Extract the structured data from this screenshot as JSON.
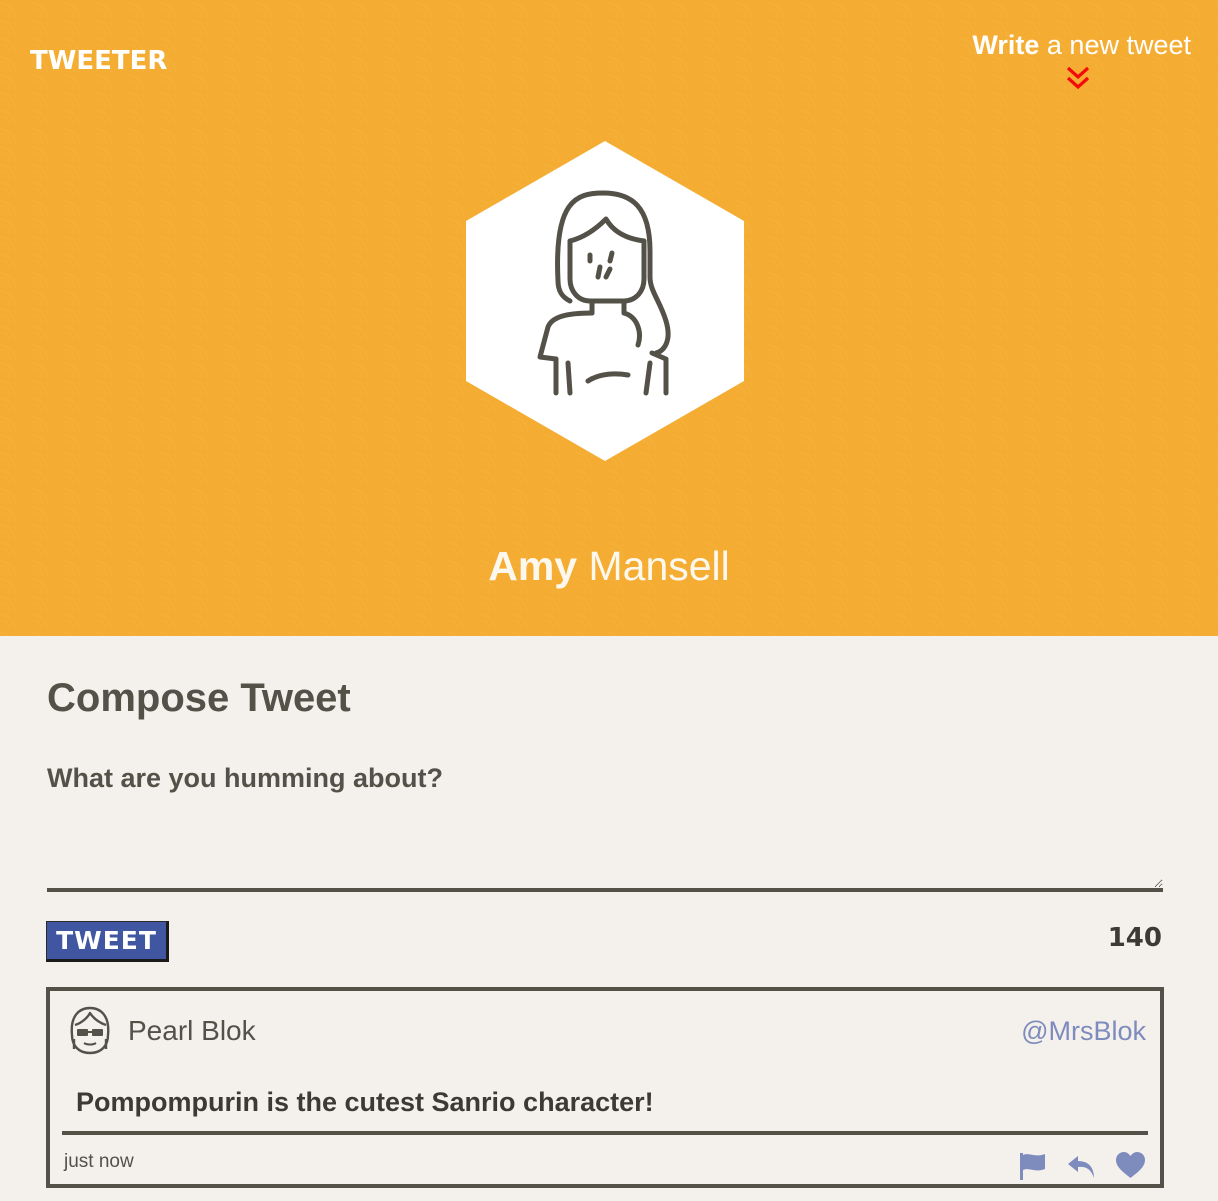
{
  "header": {
    "brand": "TWEETER",
    "write_bold": "Write",
    "write_rest": "a new tweet",
    "toggle_icon": "double-chevron-down-icon",
    "toggle_icon_color": "#f50a0a"
  },
  "profile": {
    "avatar_icon": "woman-avatar-icon",
    "first_name": "Amy",
    "last_name": "Mansell",
    "banner_color": "#f4ad32"
  },
  "compose": {
    "title": "Compose Tweet",
    "placeholder": "What are you humming about?",
    "value": "",
    "submit_label": "TWEET",
    "char_count": "140",
    "submit_color": "#4056a1"
  },
  "tweets": [
    {
      "avatar_icon": "glasses-avatar-icon",
      "name": "Pearl Blok",
      "handle": "@MrsBlok",
      "text": "Pompompurin is the cutest Sanrio character!",
      "time": "just now",
      "actions": [
        "flag-icon",
        "retweet-icon",
        "heart-icon"
      ],
      "action_color": "#7d8bbd"
    }
  ]
}
